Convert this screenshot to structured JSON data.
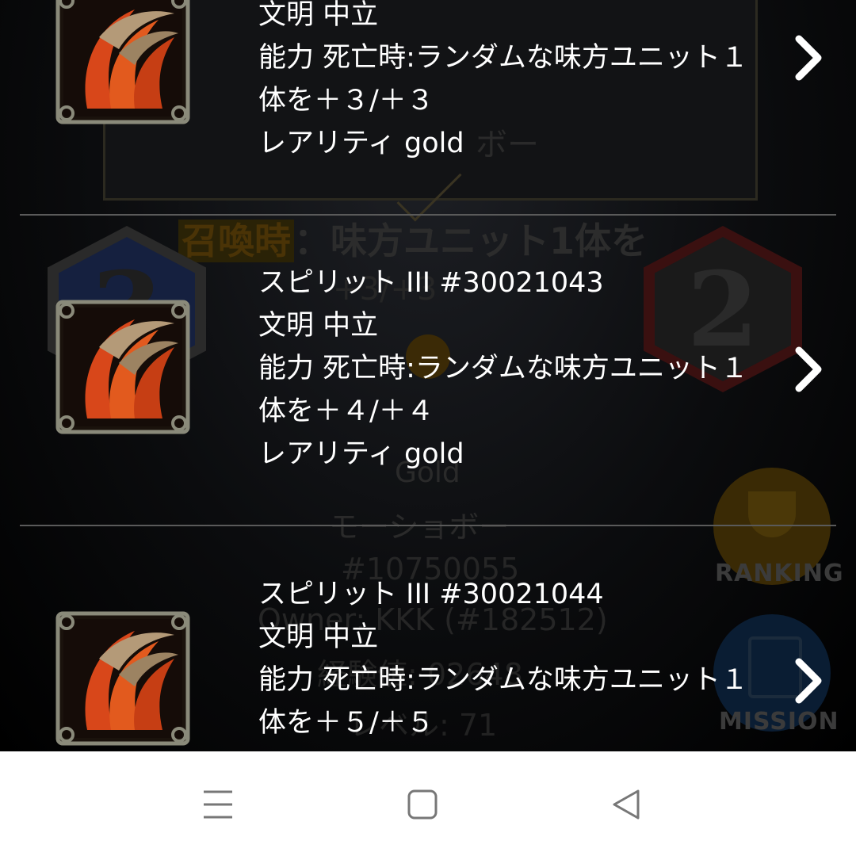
{
  "background_card": {
    "name_fragment": "ボー",
    "effect": "召喚時：味方ユニット1体を",
    "effect_tag": "召喚時",
    "effect_rest": "：味方ユニット1体を",
    "stat_fragment": "+3/+3",
    "cost": "3",
    "power": "2",
    "rarity": "Gold",
    "card_name": "モーショボー",
    "card_id": "#10750055",
    "owner": "Owner: KKK (#182512)",
    "exp": "経験値: 02648",
    "level": "レベル: 71",
    "ranking_label": "RANKING",
    "mission_label": "MISSION",
    "colors": {
      "cost_hex": "#1c2a55",
      "power_hex": "#5a1414",
      "ranking_btn": "#6a4a05",
      "mission_btn": "#0e2a4a"
    }
  },
  "items": [
    {
      "lines": [
        "文明 中立",
        "能力 死亡時:ランダムな味方ユニット１",
        "体を＋３/＋３",
        "レアリティ gold"
      ],
      "icon": "claw-icon"
    },
    {
      "lines": [
        "スピリット III #30021043",
        "文明 中立",
        "能力 死亡時:ランダムな味方ユニット１",
        "体を＋４/＋４",
        "レアリティ gold"
      ],
      "icon": "claw-icon"
    },
    {
      "lines": [
        "スピリット III #30021044",
        "文明 中立",
        "能力 死亡時:ランダムな味方ユニット１",
        "体を＋５/＋５"
      ],
      "icon": "claw-icon"
    }
  ],
  "navbar": {
    "menu_icon": "menu-icon",
    "home_icon": "home-square-icon",
    "back_icon": "back-triangle-icon"
  }
}
